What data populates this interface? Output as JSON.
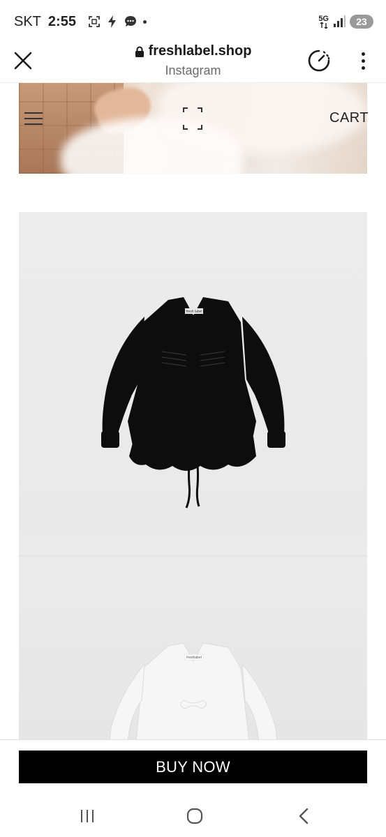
{
  "status_bar": {
    "carrier": "SKT",
    "time": "2:55",
    "network_label": "5G",
    "battery_level": "23"
  },
  "browser": {
    "domain": "freshlabel.shop",
    "source_app": "Instagram"
  },
  "site_header": {
    "cart_label": "CART"
  },
  "product": {
    "tag_black": "fresh label",
    "tag_white": "freshlabel"
  },
  "cta": {
    "buy_label": "BUY NOW"
  },
  "colors": {
    "buy_button_bg": "#000000",
    "buy_button_text": "#ffffff",
    "battery_bg": "#9a9a9a"
  },
  "icons": [
    "close-icon",
    "lock-icon",
    "speed-icon",
    "more-icon",
    "menu-icon",
    "logo-mark",
    "recents-icon",
    "home-icon",
    "back-icon"
  ]
}
